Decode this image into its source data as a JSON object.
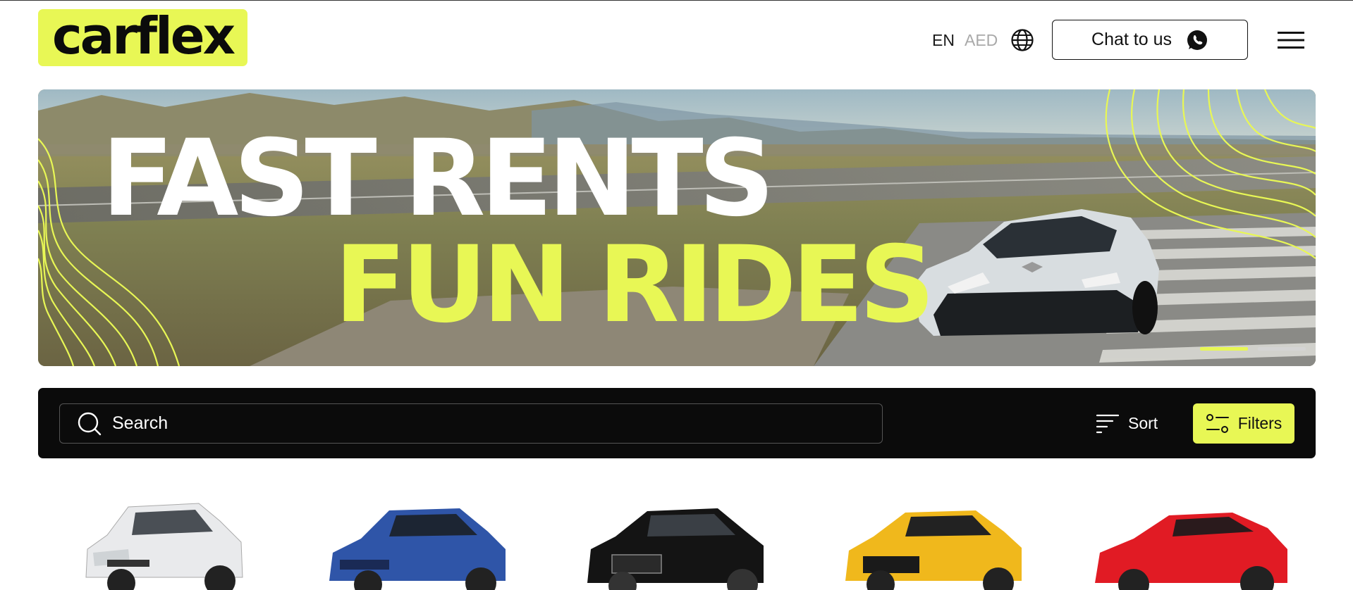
{
  "header": {
    "logo_text": "carflex",
    "language": "EN",
    "currency": "AED",
    "chat_label": "Chat to us"
  },
  "hero": {
    "line1": "FAST RENTS",
    "line2": "FUN RIDES",
    "slides": {
      "count": 2,
      "active": 1
    }
  },
  "toolbar": {
    "search_placeholder": "Search",
    "sort_label": "Sort",
    "filters_label": "Filters"
  },
  "cars": [
    {
      "body": "hatchback",
      "color": "#e9eaec"
    },
    {
      "body": "sedan",
      "color": "#2f55a8"
    },
    {
      "body": "luxury-sedan",
      "color": "#141414"
    },
    {
      "body": "sedan",
      "color": "#f0b81c"
    },
    {
      "body": "sports-coupe",
      "color": "#e11b24"
    }
  ],
  "colors": {
    "accent": "#e8f755",
    "dark": "#0b0b0b"
  }
}
